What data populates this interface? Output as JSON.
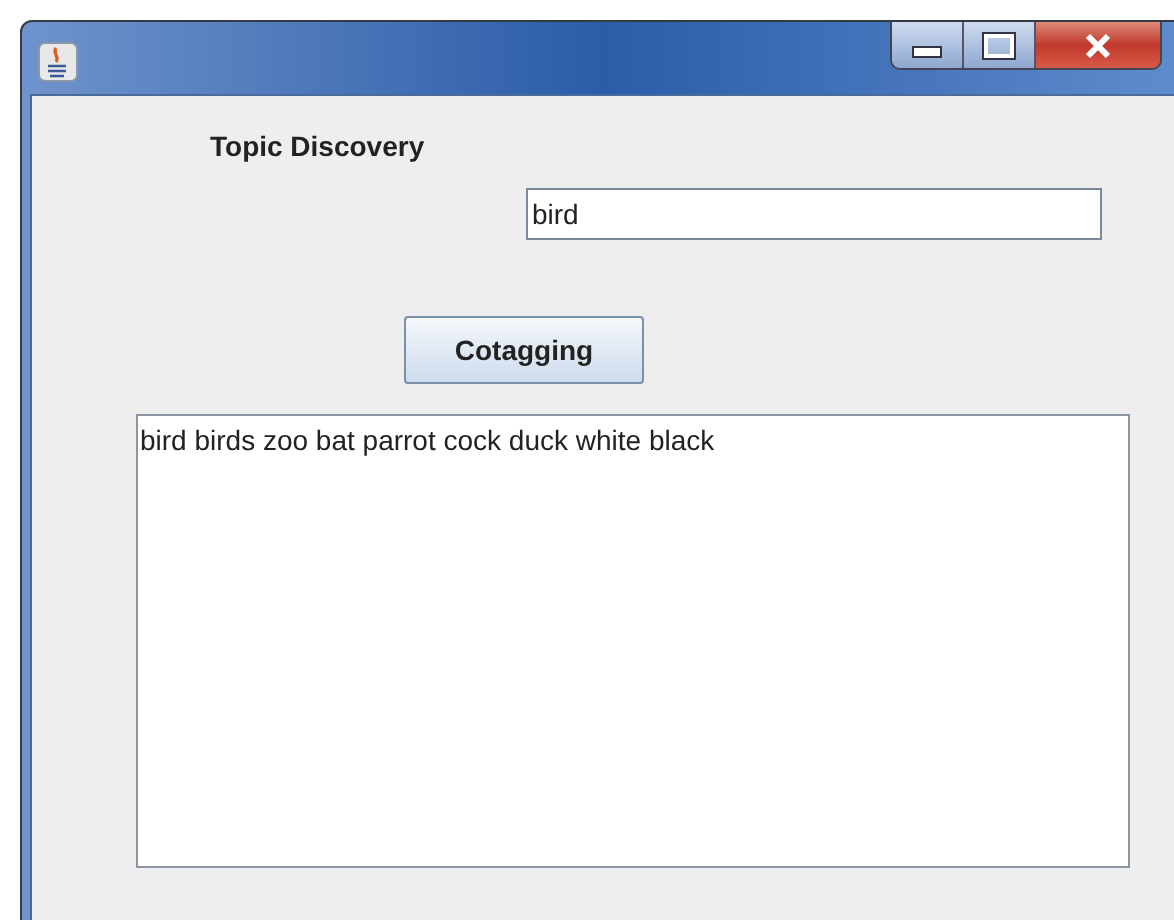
{
  "heading": "Topic Discovery",
  "query_field": {
    "value": "bird"
  },
  "button": "Cotagging",
  "output_area": {
    "value": "bird birds zoo bat parrot cock duck white black"
  }
}
